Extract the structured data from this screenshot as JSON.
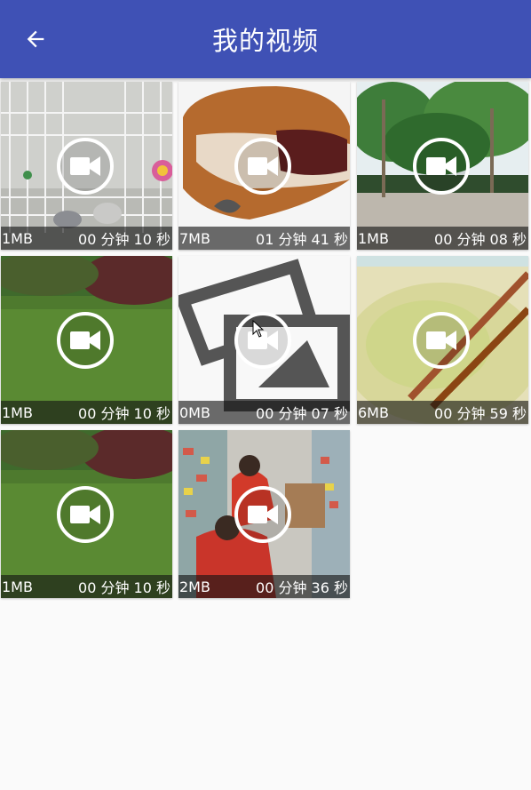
{
  "app_bar": {
    "title": "我的视频",
    "back_icon": "arrow-back-icon",
    "color": "#3f51b5"
  },
  "videos": [
    {
      "thumb": "cat-in-cage",
      "size": "1MB",
      "duration": "00 分钟 10 秒"
    },
    {
      "thumb": "pastry",
      "size": "7MB",
      "duration": "01 分钟 41 秒"
    },
    {
      "thumb": "park-trees",
      "size": "1MB",
      "duration": "00 分钟 08 秒"
    },
    {
      "thumb": "lawn-hedge",
      "size": "1MB",
      "duration": "00 分钟 10 秒"
    },
    {
      "thumb": "image-placeholder",
      "size": "0MB",
      "duration": "00 分钟 07 秒"
    },
    {
      "thumb": "rice-chopsticks",
      "size": "6MB",
      "duration": "00 分钟 59 秒"
    },
    {
      "thumb": "lawn-hedge",
      "size": "1MB",
      "duration": "00 分钟 10 秒"
    },
    {
      "thumb": "store-shelves",
      "size": "2MB",
      "duration": "00 分钟 36 秒"
    }
  ],
  "overlay_icon": "video-camera-icon"
}
